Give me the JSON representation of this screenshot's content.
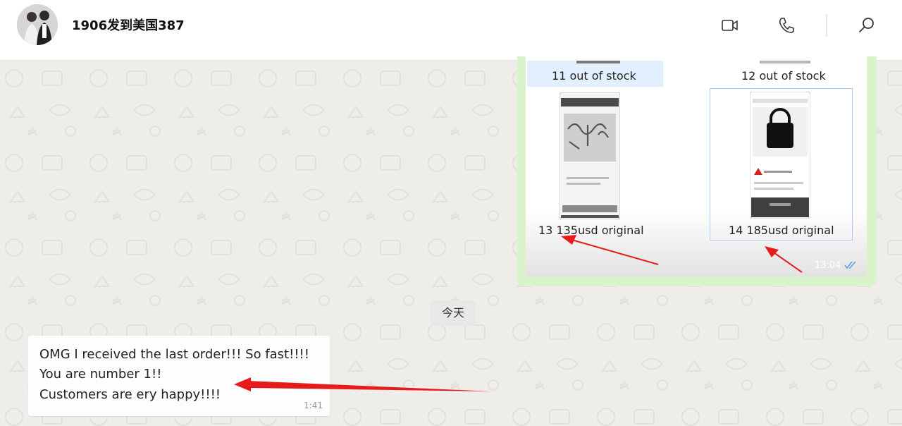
{
  "header": {
    "contact_name": "1906发到美国387",
    "icons": [
      "video-call-icon",
      "voice-call-icon",
      "search-icon"
    ]
  },
  "outgoing_message": {
    "items": [
      {
        "label": "11 out of stock"
      },
      {
        "label": "12 out of stock"
      },
      {
        "label": "13  135usd original"
      },
      {
        "label": "14  185usd original"
      }
    ],
    "time": "13:04",
    "status": "read-double-check"
  },
  "date_separator": "今天",
  "incoming_message": {
    "lines": [
      "OMG I received the last order!!! So fast!!!!",
      "You are number 1!!",
      "Customers are ery happy!!!!"
    ],
    "time": "1:41"
  },
  "colors": {
    "header_bg": "#ffffff",
    "chat_bg": "#efedea",
    "outgoing_bubble": "#d9f4cd",
    "incoming_bubble": "#fdfdfd",
    "annotation_arrow": "#e51c1c",
    "read_tick": "#5aa0e6"
  }
}
